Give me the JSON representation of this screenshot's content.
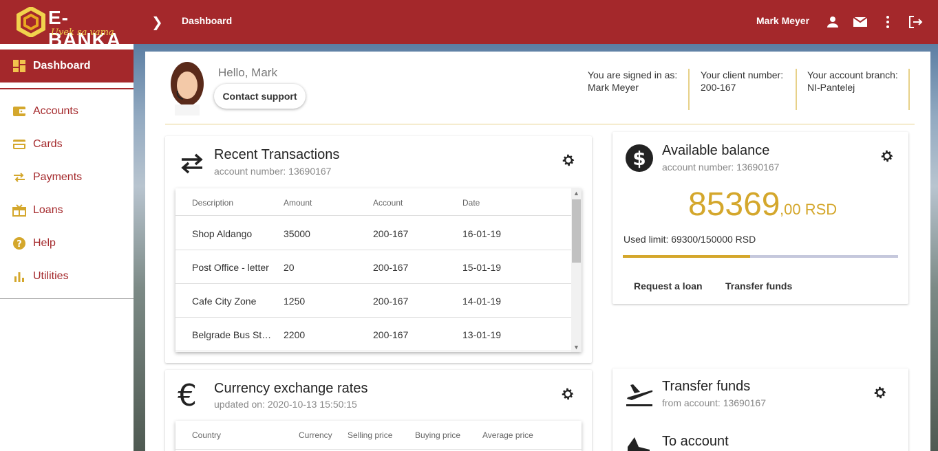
{
  "brand": {
    "name": "E-BANKA",
    "tagline": "Uvek sa vama",
    "accent": "#a4282b",
    "gold": "#d4a72c"
  },
  "breadcrumb": {
    "current": "Dashboard"
  },
  "header": {
    "user_name": "Mark Meyer",
    "icons": [
      "person-icon",
      "mail-icon",
      "more-vert-icon",
      "logout-icon"
    ]
  },
  "sidebar": {
    "items": [
      {
        "label": "Dashboard",
        "icon": "dashboard-icon",
        "active": true
      },
      {
        "label": "Accounts",
        "icon": "wallet-icon"
      },
      {
        "label": "Cards",
        "icon": "card-icon"
      },
      {
        "label": "Payments",
        "icon": "swap-icon"
      },
      {
        "label": "Loans",
        "icon": "gift-icon"
      },
      {
        "label": "Help",
        "icon": "help-icon"
      },
      {
        "label": "Utilities",
        "icon": "bar-chart-icon"
      }
    ]
  },
  "welcome": {
    "greeting": "Hello, Mark",
    "support_label": "Contact support",
    "signed_in_label": "You are signed in as:",
    "signed_in_value": "Mark Meyer",
    "client_label": "Your client number:",
    "client_value": "200-167",
    "branch_label": "Your account branch:",
    "branch_value": "NI-Pantelej"
  },
  "transactions": {
    "title": "Recent Transactions",
    "subtitle": "account number: 13690167",
    "columns": [
      "Description",
      "Amount",
      "Account",
      "Date"
    ],
    "rows": [
      [
        "Shop Aldango",
        "35000",
        "200-167",
        "16-01-19"
      ],
      [
        "Post Office - letter",
        "20",
        "200-167",
        "15-01-19"
      ],
      [
        "Cafe City Zone",
        "1250",
        "200-167",
        "14-01-19"
      ],
      [
        "Belgrade Bus Station",
        "2200",
        "200-167",
        "13-01-19"
      ]
    ]
  },
  "balance": {
    "title": "Available balance",
    "subtitle": "account number: 13690167",
    "amount": "85369",
    "decimals": ",00 RSD",
    "limit_text": "Used limit: 69300/150000 RSD",
    "limit_fraction": 0.462,
    "request_loan": "Request a loan",
    "transfer_funds": "Transfer funds"
  },
  "exchange": {
    "title": "Currency exchange rates",
    "subtitle": "updated on: 2020-10-13 15:50:15",
    "columns": [
      "Country",
      "Currency",
      "Selling price",
      "Buying price",
      "Average price"
    ]
  },
  "transfer": {
    "title": "Transfer funds",
    "subtitle": "from account: 13690167",
    "to_label": "To account"
  }
}
